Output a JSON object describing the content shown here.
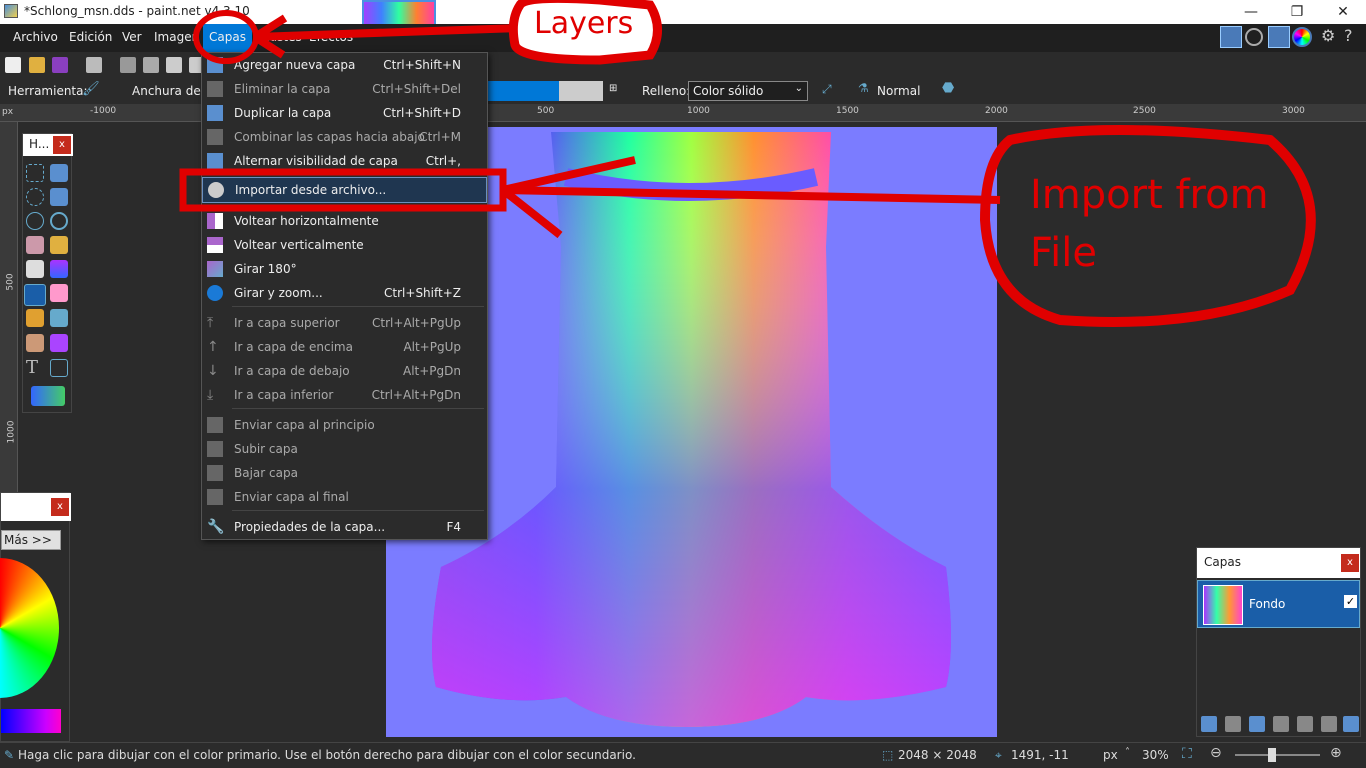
{
  "window": {
    "title": "*Schlong_msn.dds - paint.net v4.3.10",
    "minimize": "—",
    "restore": "❐",
    "close": "✕"
  },
  "menubar": [
    "Archivo",
    "Edición",
    "Ver",
    "Imagen",
    "Capas",
    "Ajustes",
    "Efectos"
  ],
  "toolbar2": {
    "tool_label": "Herramienta:",
    "width_label": "Anchura del p",
    "fill_label": "Relleno:",
    "fill_value": "Color sólido",
    "blend_value": "Normal"
  },
  "ruler_h": [
    "px",
    "-1000",
    "500",
    "1000",
    "1500",
    "2000",
    "2500",
    "3000"
  ],
  "ruler_v": [
    "500",
    "1000"
  ],
  "menu": {
    "items": [
      {
        "label": "Agregar nueva capa",
        "shortcut": "Ctrl+Shift+N",
        "icon": "add-layer-icon",
        "disabled": false
      },
      {
        "label": "Eliminar la capa",
        "shortcut": "Ctrl+Shift+Del",
        "icon": "delete-layer-icon",
        "disabled": true
      },
      {
        "label": "Duplicar la capa",
        "shortcut": "Ctrl+Shift+D",
        "icon": "duplicate-layer-icon",
        "disabled": false
      },
      {
        "label": "Combinar las capas hacia abajo",
        "shortcut": "Ctrl+M",
        "icon": "merge-down-icon",
        "disabled": true
      },
      {
        "label": "Alternar visibilidad de capa",
        "shortcut": "Ctrl+,",
        "icon": "visibility-icon",
        "disabled": false
      },
      {
        "label": "Importar desde archivo...",
        "shortcut": "",
        "icon": "import-icon",
        "disabled": false
      },
      {
        "label": "Voltear horizontalmente",
        "shortcut": "",
        "icon": "flip-horizontal-icon",
        "disabled": false
      },
      {
        "label": "Voltear verticalmente",
        "shortcut": "",
        "icon": "flip-vertical-icon",
        "disabled": false
      },
      {
        "label": "Girar 180°",
        "shortcut": "",
        "icon": "rotate-180-icon",
        "disabled": false
      },
      {
        "label": "Girar y zoom...",
        "shortcut": "Ctrl+Shift+Z",
        "icon": "rotate-zoom-icon",
        "disabled": false
      },
      {
        "label": "Ir a capa superior",
        "shortcut": "Ctrl+Alt+PgUp",
        "icon": "go-top-icon",
        "disabled": true
      },
      {
        "label": "Ir a capa de encima",
        "shortcut": "Alt+PgUp",
        "icon": "go-up-icon",
        "disabled": true
      },
      {
        "label": "Ir a capa de debajo",
        "shortcut": "Alt+PgDn",
        "icon": "go-down-icon",
        "disabled": true
      },
      {
        "label": "Ir a capa inferior",
        "shortcut": "Ctrl+Alt+PgDn",
        "icon": "go-bottom-icon",
        "disabled": true
      },
      {
        "label": "Enviar capa al principio",
        "shortcut": "",
        "icon": "send-top-icon",
        "disabled": true
      },
      {
        "label": "Subir capa",
        "shortcut": "",
        "icon": "move-up-icon",
        "disabled": true
      },
      {
        "label": "Bajar capa",
        "shortcut": "",
        "icon": "move-down-icon",
        "disabled": true
      },
      {
        "label": "Enviar capa al final",
        "shortcut": "",
        "icon": "send-bottom-icon",
        "disabled": true
      },
      {
        "label": "Propiedades de la capa...",
        "shortcut": "F4",
        "icon": "wrench-icon",
        "disabled": false
      }
    ]
  },
  "tools_panel": {
    "title": "H...",
    "close": "x"
  },
  "colors_panel": {
    "more": "Más >>",
    "close": "x"
  },
  "layers_panel": {
    "title": "Capas",
    "close": "x",
    "layer_name": "Fondo",
    "visible": true
  },
  "annotations": {
    "layers": "Layers",
    "import_line1": "Import from",
    "import_line2": "File"
  },
  "status": {
    "hint": "Haga clic para dibujar con el color primario. Use el botón derecho para dibujar con el color secundario.",
    "size": "2048 × 2048",
    "pointer": "1491, -11",
    "unit": "px",
    "zoom": "30%"
  },
  "colors": {
    "accent": "#0078d7",
    "annotation": "#e00000",
    "canvas": "#7b7cff",
    "menu_bg": "#2b2b2b"
  }
}
